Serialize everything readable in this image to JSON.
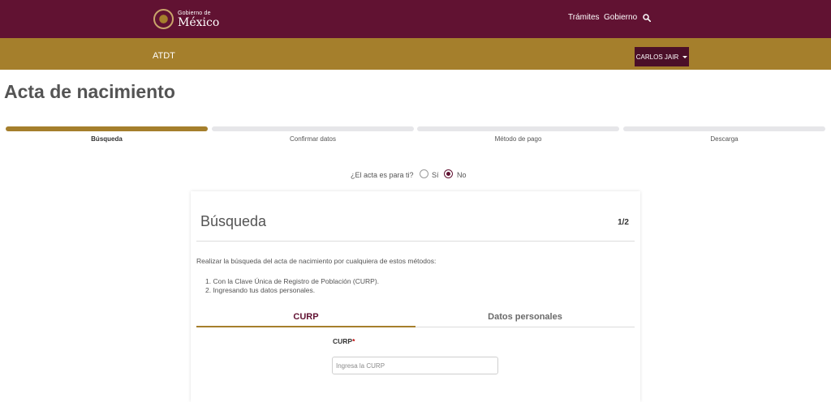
{
  "header": {
    "logo_small": "Gobierno de",
    "logo_big": "México",
    "nav": [
      {
        "label": "Trámites"
      },
      {
        "label": "Gobierno"
      }
    ],
    "search_icon": "search-icon"
  },
  "subheader": {
    "org": "ATDT",
    "user_label": "CARLOS JAIR"
  },
  "page": {
    "title": "Acta de nacimiento"
  },
  "steps": [
    {
      "label": "Búsqueda",
      "active": true
    },
    {
      "label": "Confirmar datos",
      "active": false
    },
    {
      "label": "Método de pago",
      "active": false
    },
    {
      "label": "Descarga",
      "active": false
    }
  ],
  "question": {
    "text": "¿El acta es para ti?",
    "options": [
      {
        "label": "Sí",
        "selected": false
      },
      {
        "label": "No",
        "selected": true
      }
    ]
  },
  "card": {
    "title": "Búsqueda",
    "step_indicator": "1/2",
    "description": "Realizar la búsqueda del acta de nacimiento por cualquiera de estos métodos:",
    "methods": [
      "1. Con la Clave Única de Registro de Población (CURP).",
      "2. Ingresando tus datos personales."
    ],
    "tabs": [
      {
        "label": "CURP",
        "active": true
      },
      {
        "label": "Datos personales",
        "active": false
      }
    ],
    "field": {
      "label": "CURP",
      "required_mark": "*",
      "placeholder": "Ingresa la CURP",
      "value": ""
    }
  },
  "colors": {
    "primary": "#611232",
    "gold": "#a57f2c",
    "step_inactive": "#e6e6e9"
  }
}
